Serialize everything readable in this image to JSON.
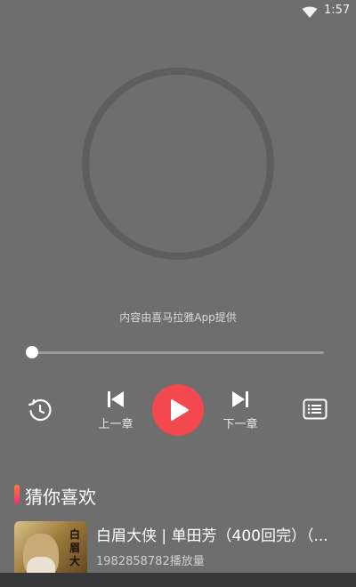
{
  "status_bar": {
    "time": "1:57",
    "wifi_icon": "wifi-icon"
  },
  "player": {
    "credit_text": "内容由喜马拉雅App提供",
    "progress_fraction": 0.0,
    "controls": {
      "history_icon": "history-icon",
      "prev_label": "上一章",
      "prev_icon": "skip-previous-icon",
      "play_icon": "play-icon",
      "play_color": "#f2484e",
      "next_label": "下一章",
      "next_icon": "skip-next-icon",
      "list_icon": "playlist-icon"
    }
  },
  "recommend": {
    "title": "猜你喜欢",
    "accent_gradient": [
      "#ff7a3d",
      "#f0336b"
    ],
    "items": [
      {
        "cover_text": "白眉大",
        "title": "白眉大侠 | 单田芳（400回完）（...",
        "plays": "1982858782播放量"
      }
    ]
  },
  "colors": {
    "background": "#6e6e6e",
    "disc_ring": "#5e5e5e"
  }
}
